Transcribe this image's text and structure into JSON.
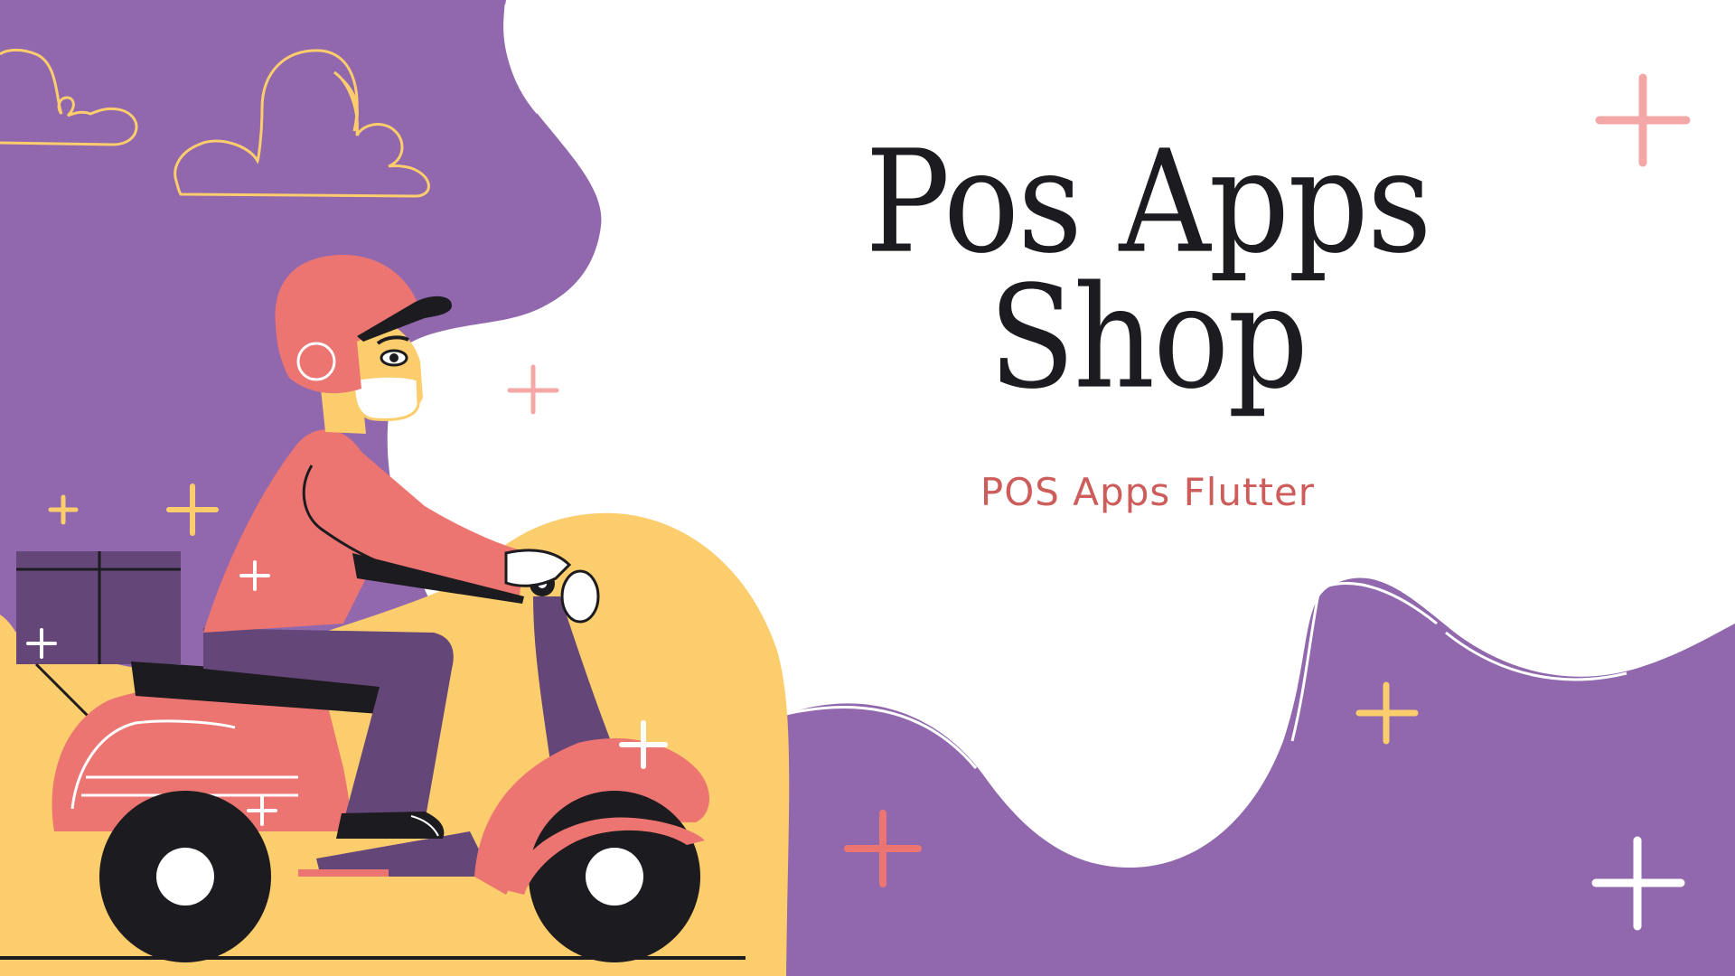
{
  "title": {
    "line1": "Pos Apps",
    "line2": "Shop"
  },
  "subtitle": "POS Apps Flutter",
  "colors": {
    "purple": "#9168ad",
    "yellow": "#fccd6c",
    "coral": "#ec7571",
    "dark_purple": "#644678",
    "ink": "#1c1b1f",
    "white": "#ffffff",
    "pink": "#f4a7a7",
    "subtitle": "#cd5d5a"
  },
  "illustration": {
    "subject": "delivery-rider-on-scooter",
    "icons": [
      "cloud-icon",
      "sparkle-plus-icon",
      "package-box-icon",
      "scooter-icon",
      "helmet-icon"
    ]
  }
}
